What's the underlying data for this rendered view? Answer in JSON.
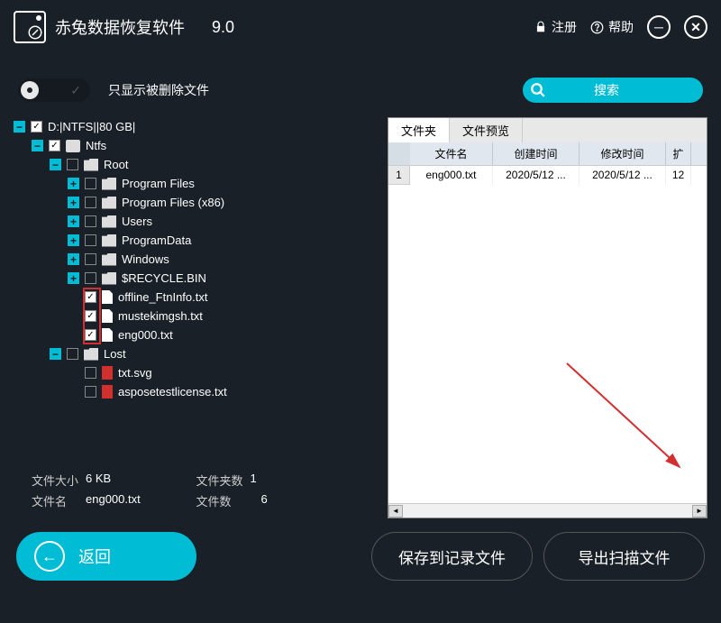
{
  "header": {
    "title": "赤兔数据恢复软件",
    "version": "9.0",
    "register": "注册",
    "help": "帮助"
  },
  "toolbar": {
    "filter_label": "只显示被删除文件",
    "search": "搜索"
  },
  "tree": {
    "root": "D:|NTFS||80 GB|",
    "ntfs": "Ntfs",
    "root_folder": "Root",
    "pf": "Program Files",
    "pfx86": "Program Files (x86)",
    "users": "Users",
    "programdata": "ProgramData",
    "windows": "Windows",
    "recycle": "$RECYCLE.BIN",
    "offline": "offline_FtnInfo.txt",
    "mustek": "mustekimgsh.txt",
    "eng": "eng000.txt",
    "lost": "Lost",
    "txtsvg": "txt.svg",
    "aspose": "asposetestlicense.txt"
  },
  "stats": {
    "size_k": "文件大小",
    "size_v": "6 KB",
    "folders_k": "文件夹数",
    "folders_v": "1",
    "name_k": "文件名",
    "name_v": "eng000.txt",
    "files_k": "文件数",
    "files_v": "6"
  },
  "preview": {
    "tab_folder": "文件夹",
    "tab_preview": "文件预览",
    "col_name": "文件名",
    "col_ctime": "创建时间",
    "col_mtime": "修改时间",
    "col_ext": "扩",
    "rows": [
      {
        "num": "1",
        "name": "eng000.txt",
        "ctime": "2020/5/12  ...",
        "mtime": "2020/5/12  ...",
        "ext": "12"
      }
    ]
  },
  "chart_data": {
    "type": "table",
    "columns": [
      "文件名",
      "创建时间",
      "修改时间"
    ],
    "rows": [
      [
        "eng000.txt",
        "2020/5/12",
        "2020/5/12"
      ]
    ]
  },
  "bottom": {
    "back": "返回",
    "save": "保存到记录文件",
    "export": "导出扫描文件"
  }
}
